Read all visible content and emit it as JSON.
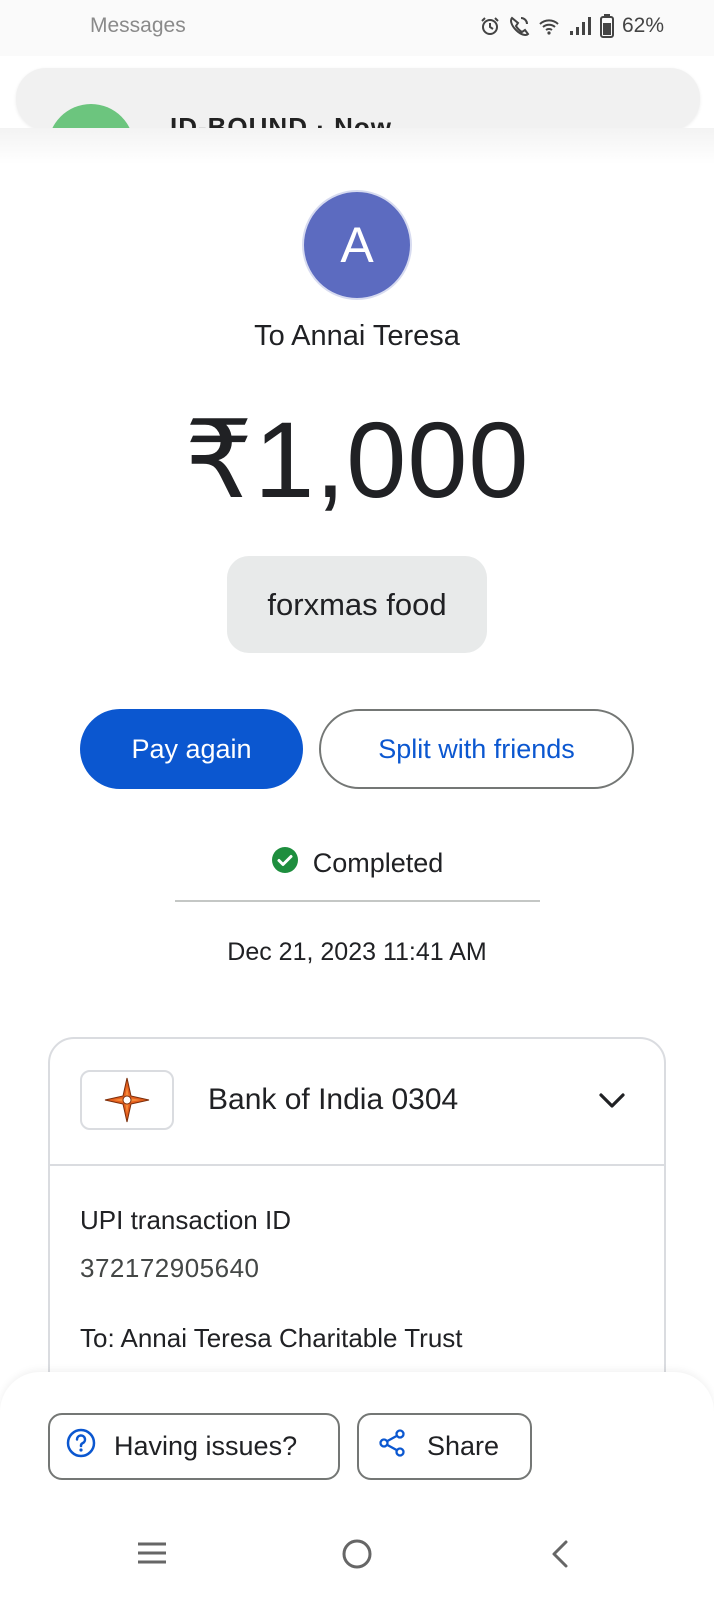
{
  "status_bar": {
    "app_name": "Messages",
    "battery": "62%",
    "icons": [
      "alarm-icon",
      "wifi-calling-icon",
      "wifi-icon",
      "signal-icon",
      "battery-icon"
    ]
  },
  "notification": {
    "sender": "ID-BOUND · Now"
  },
  "payment": {
    "avatar_letter": "A",
    "recipient": "To Annai Teresa",
    "amount": "₹1,000",
    "note": "forxmas food",
    "status": "Completed",
    "datetime": "Dec 21, 2023 11:41 AM"
  },
  "actions": {
    "pay_again": "Pay again",
    "split": "Split with friends"
  },
  "details": {
    "bank_name": "Bank of India 0304",
    "txn_label": "UPI transaction ID",
    "txn_id": "372172905640",
    "to_line": "To: Annai Teresa Charitable Trust"
  },
  "bottom": {
    "issues": "Having issues?",
    "share": "Share"
  },
  "colors": {
    "primary": "#0b57d0",
    "avatar": "#5c6bc0",
    "success": "#1e8e3e",
    "bank_star": "#e35d1c"
  }
}
